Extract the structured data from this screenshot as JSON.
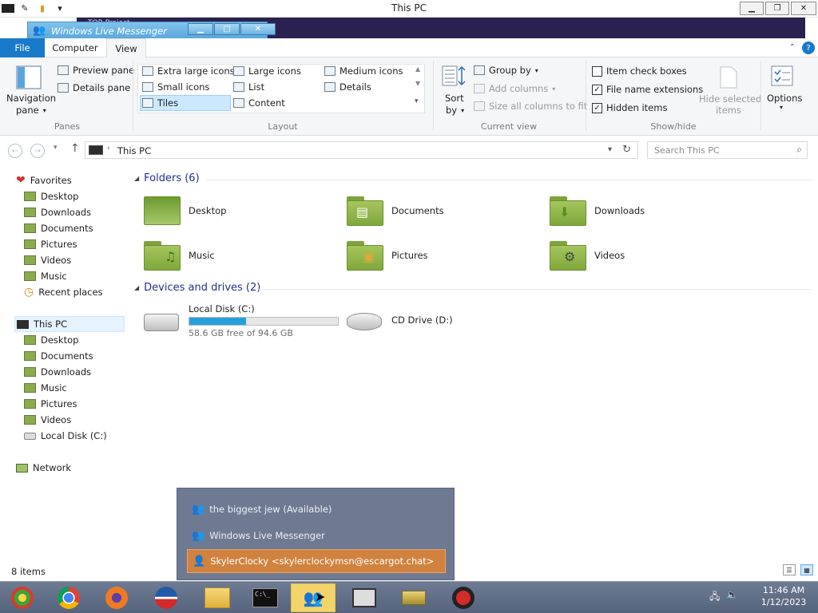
{
  "window": {
    "title": "This PC"
  },
  "underlay": {
    "text": "TOR Project..."
  },
  "messenger": {
    "title": "Windows Live Messenger"
  },
  "ribbon": {
    "tabs": {
      "file": "File",
      "computer": "Computer",
      "view": "View"
    },
    "panes": {
      "nav_pane_line1": "Navigation",
      "nav_pane_line2": "pane",
      "preview_pane": "Preview pane",
      "details_pane": "Details pane",
      "label": "Panes"
    },
    "layout": {
      "extra_large_icons": "Extra large icons",
      "large_icons": "Large icons",
      "medium_icons": "Medium icons",
      "small_icons": "Small icons",
      "list": "List",
      "details": "Details",
      "tiles": "Tiles",
      "content": "Content",
      "label": "Layout"
    },
    "current_view": {
      "sort_by_line1": "Sort",
      "sort_by_line2": "by",
      "group_by": "Group by",
      "add_columns": "Add columns",
      "size_columns": "Size all columns to fit",
      "label": "Current view"
    },
    "show_hide": {
      "item_check_boxes": "Item check boxes",
      "file_name_extensions": "File name extensions",
      "hidden_items": "Hidden items",
      "hide_selected_line1": "Hide selected",
      "hide_selected_line2": "items",
      "label": "Show/hide"
    },
    "options": "Options"
  },
  "address": {
    "crumb": "This PC",
    "search_placeholder": "Search This PC"
  },
  "nav": {
    "favorites": "Favorites",
    "fav_items": [
      "Desktop",
      "Downloads",
      "Documents",
      "Pictures",
      "Videos",
      "Music",
      "Recent places"
    ],
    "this_pc": "This PC",
    "pc_items": [
      "Desktop",
      "Documents",
      "Downloads",
      "Music",
      "Pictures",
      "Videos",
      "Local Disk (C:)"
    ],
    "network": "Network"
  },
  "content": {
    "folders_header": "Folders (6)",
    "folders": [
      "Desktop",
      "Documents",
      "Downloads",
      "Music",
      "Pictures",
      "Videos"
    ],
    "devices_header": "Devices and drives (2)",
    "drive_c": {
      "name": "Local Disk (C:)",
      "free": "58.6 GB free of 94.6 GB",
      "used_fraction": 0.38
    },
    "drive_d": {
      "name": "CD Drive (D:)"
    }
  },
  "status": {
    "items": "8 items"
  },
  "popup": {
    "items": [
      "the biggest jew (Available)",
      "Windows Live Messenger",
      "SkylerClocky <skylerclockymsn@escargot.chat>"
    ]
  },
  "clock": {
    "time": "11:46 AM",
    "date": "1/12/2023"
  }
}
